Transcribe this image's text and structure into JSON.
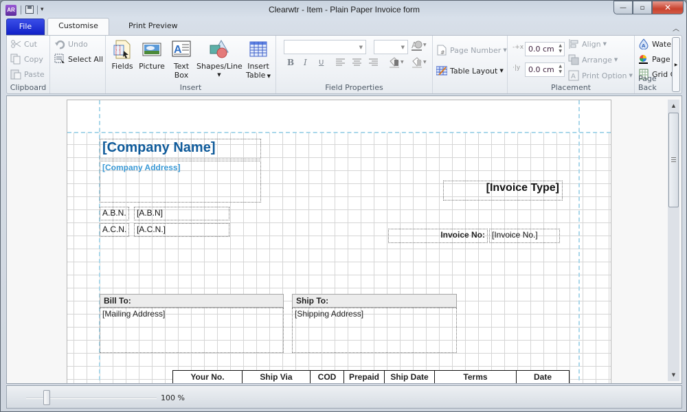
{
  "app": {
    "icon_text": "AR",
    "title": "Clearwtr - Item - Plain Paper Invoice form"
  },
  "window_controls": {
    "minimize": "—",
    "maximize": "▫",
    "close": "✕"
  },
  "tabs": [
    {
      "label": "File"
    },
    {
      "label": "Customise",
      "active": true
    },
    {
      "label": "Print Preview"
    }
  ],
  "ribbon": {
    "clipboard": {
      "label": "Clipboard",
      "cut": "Cut",
      "copy": "Copy",
      "paste": "Paste"
    },
    "edit": {
      "undo": "Undo",
      "select_all": "Select All"
    },
    "insert": {
      "label": "Insert",
      "fields": "Fields",
      "picture": "Picture",
      "text_box_1": "Text",
      "text_box_2": "Box",
      "shapes_line": "Shapes/Line",
      "insert_table_1": "Insert",
      "insert_table_2": "Table"
    },
    "field_properties": {
      "label": "Field Properties",
      "font_name": "",
      "font_size": "",
      "bold": "B",
      "italic": "I",
      "underline": "U"
    },
    "page": {
      "page_number": "Page Number",
      "table_layout": "Table Layout"
    },
    "placement": {
      "label": "Placement",
      "x_value": "0.0 cm",
      "y_value": "0.0 cm",
      "align": "Align",
      "arrange": "Arrange",
      "print_option": "Print Option"
    },
    "page_background": {
      "label": "Page Back",
      "watermark": "Water",
      "page_color": "Page C",
      "grid": "Grid C"
    }
  },
  "document": {
    "company_name": "[Company Name]",
    "company_address": "[Company Address]",
    "abn_label": "A.B.N.",
    "abn_value": "[A.B.N]",
    "acn_label": "A.C.N.",
    "acn_value": "[A.C.N.]",
    "invoice_type": "[Invoice Type]",
    "invoice_no_label": "Invoice No:",
    "invoice_no_value": "[Invoice No.]",
    "bill_to_label": "Bill To:",
    "bill_to_value": "[Mailing Address]",
    "ship_to_label": "Ship To:",
    "ship_to_value": "[Shipping Address]",
    "info_columns": [
      "Your No.",
      "Ship Via",
      "COD",
      "Prepaid",
      "Ship Date",
      "Terms",
      "Date"
    ]
  },
  "statusbar": {
    "zoom_label": "100 %",
    "zoom_percent": 100
  }
}
